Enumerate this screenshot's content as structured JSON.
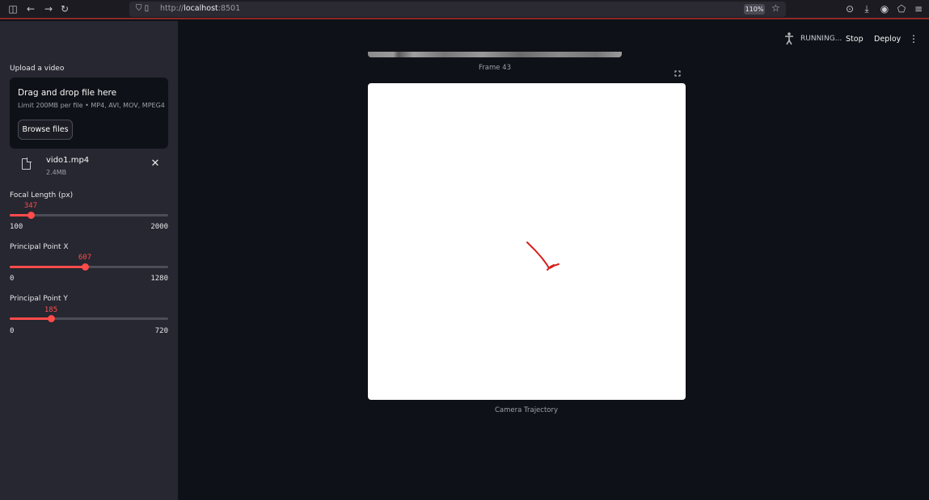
{
  "browser": {
    "url_prefix": "http://",
    "url_host": "localhost",
    "url_port": ":8501",
    "zoom": "110%"
  },
  "header": {
    "status": "RUNNING...",
    "stop_label": "Stop",
    "deploy_label": "Deploy"
  },
  "sidebar": {
    "upload_label": "Upload a video",
    "dropzone_title": "Drag and drop file here",
    "dropzone_limit": "Limit 200MB per file • MP4, AVI, MOV, MPEG4",
    "browse_label": "Browse files",
    "file_name": "vido1.mp4",
    "file_size": "2.4MB",
    "sliders": [
      {
        "label": "Focal Length (px)",
        "value": "347",
        "min": "100",
        "max": "2000"
      },
      {
        "label": "Principal Point X",
        "value": "607",
        "min": "0",
        "max": "1280"
      },
      {
        "label": "Principal Point Y",
        "value": "185",
        "min": "0",
        "max": "720"
      }
    ]
  },
  "main": {
    "frame_caption": "Frame 43",
    "plot_caption": "Camera Trajectory"
  },
  "colors": {
    "accent": "#ff4b4b",
    "background": "#0e1117",
    "sidebar": "#262730"
  }
}
